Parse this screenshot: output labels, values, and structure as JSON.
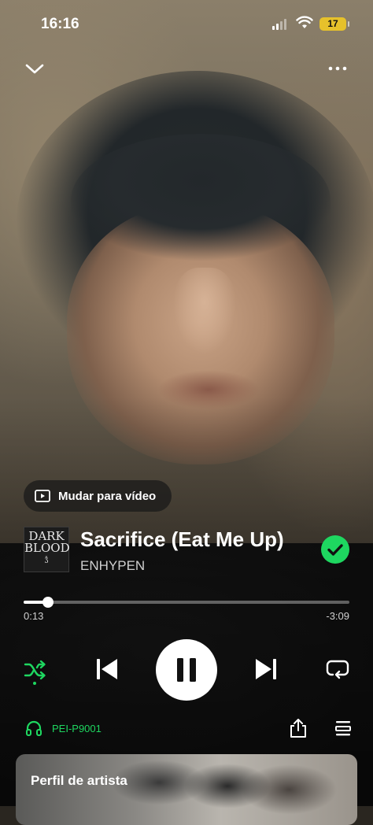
{
  "status_bar": {
    "time": "16:16",
    "battery": "17"
  },
  "video_toggle": {
    "label": "Mudar para vídeo"
  },
  "track": {
    "title": "Sacrifice (Eat Me Up)",
    "artist": "ENHYPEN",
    "cover_text": {
      "line1": "DARK",
      "line2": "BLOOD"
    },
    "liked": true
  },
  "progress": {
    "elapsed": "0:13",
    "remaining": "-3:09",
    "fraction": 0.074
  },
  "playback": {
    "state": "playing",
    "shuffle": true
  },
  "device": {
    "name": "PEI-P9001"
  },
  "artist_card": {
    "title": "Perfil de artista"
  },
  "colors": {
    "accent": "#1ed760",
    "battery": "#e6c12b"
  }
}
